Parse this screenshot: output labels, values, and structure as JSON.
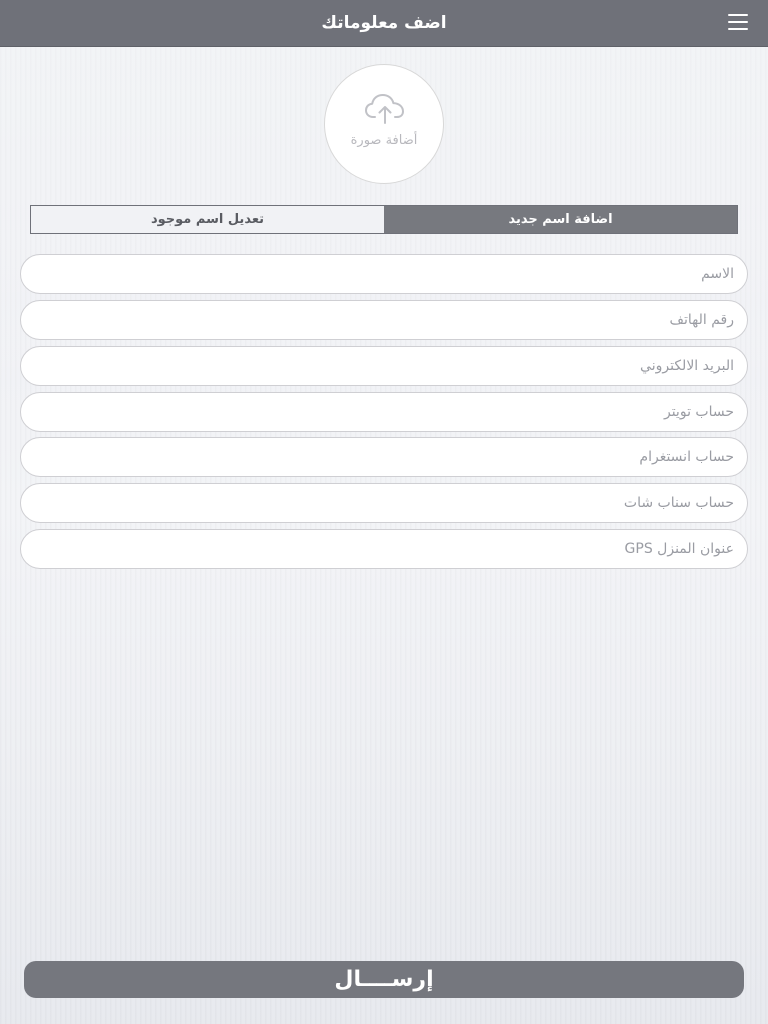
{
  "header": {
    "title": "اضف معلوماتك",
    "menu_icon": "hamburger-menu-icon"
  },
  "photo_upload": {
    "label": "أضافة صورة",
    "icon": "cloud-upload-icon"
  },
  "tabs": {
    "new_name": "اضافة اسم جديد",
    "edit_existing": "تعديل اسم موجود",
    "active": "new_name"
  },
  "fields": {
    "name": {
      "placeholder": "الاسم",
      "value": ""
    },
    "phone": {
      "placeholder": "رقم الهاتف",
      "value": ""
    },
    "email": {
      "placeholder": "البريد الالكتروني",
      "value": ""
    },
    "twitter": {
      "placeholder": "حساب تويتر",
      "value": ""
    },
    "instagram": {
      "placeholder": "حساب انستغرام",
      "value": ""
    },
    "snapchat": {
      "placeholder": "حساب سناب شات",
      "value": ""
    },
    "gps": {
      "placeholder": "عنوان المنزل GPS",
      "value": ""
    }
  },
  "submit": {
    "label": "إرســــال"
  },
  "colors": {
    "header": "#6f7179",
    "active_tab": "#77797f",
    "submit_button": "#75777e"
  }
}
